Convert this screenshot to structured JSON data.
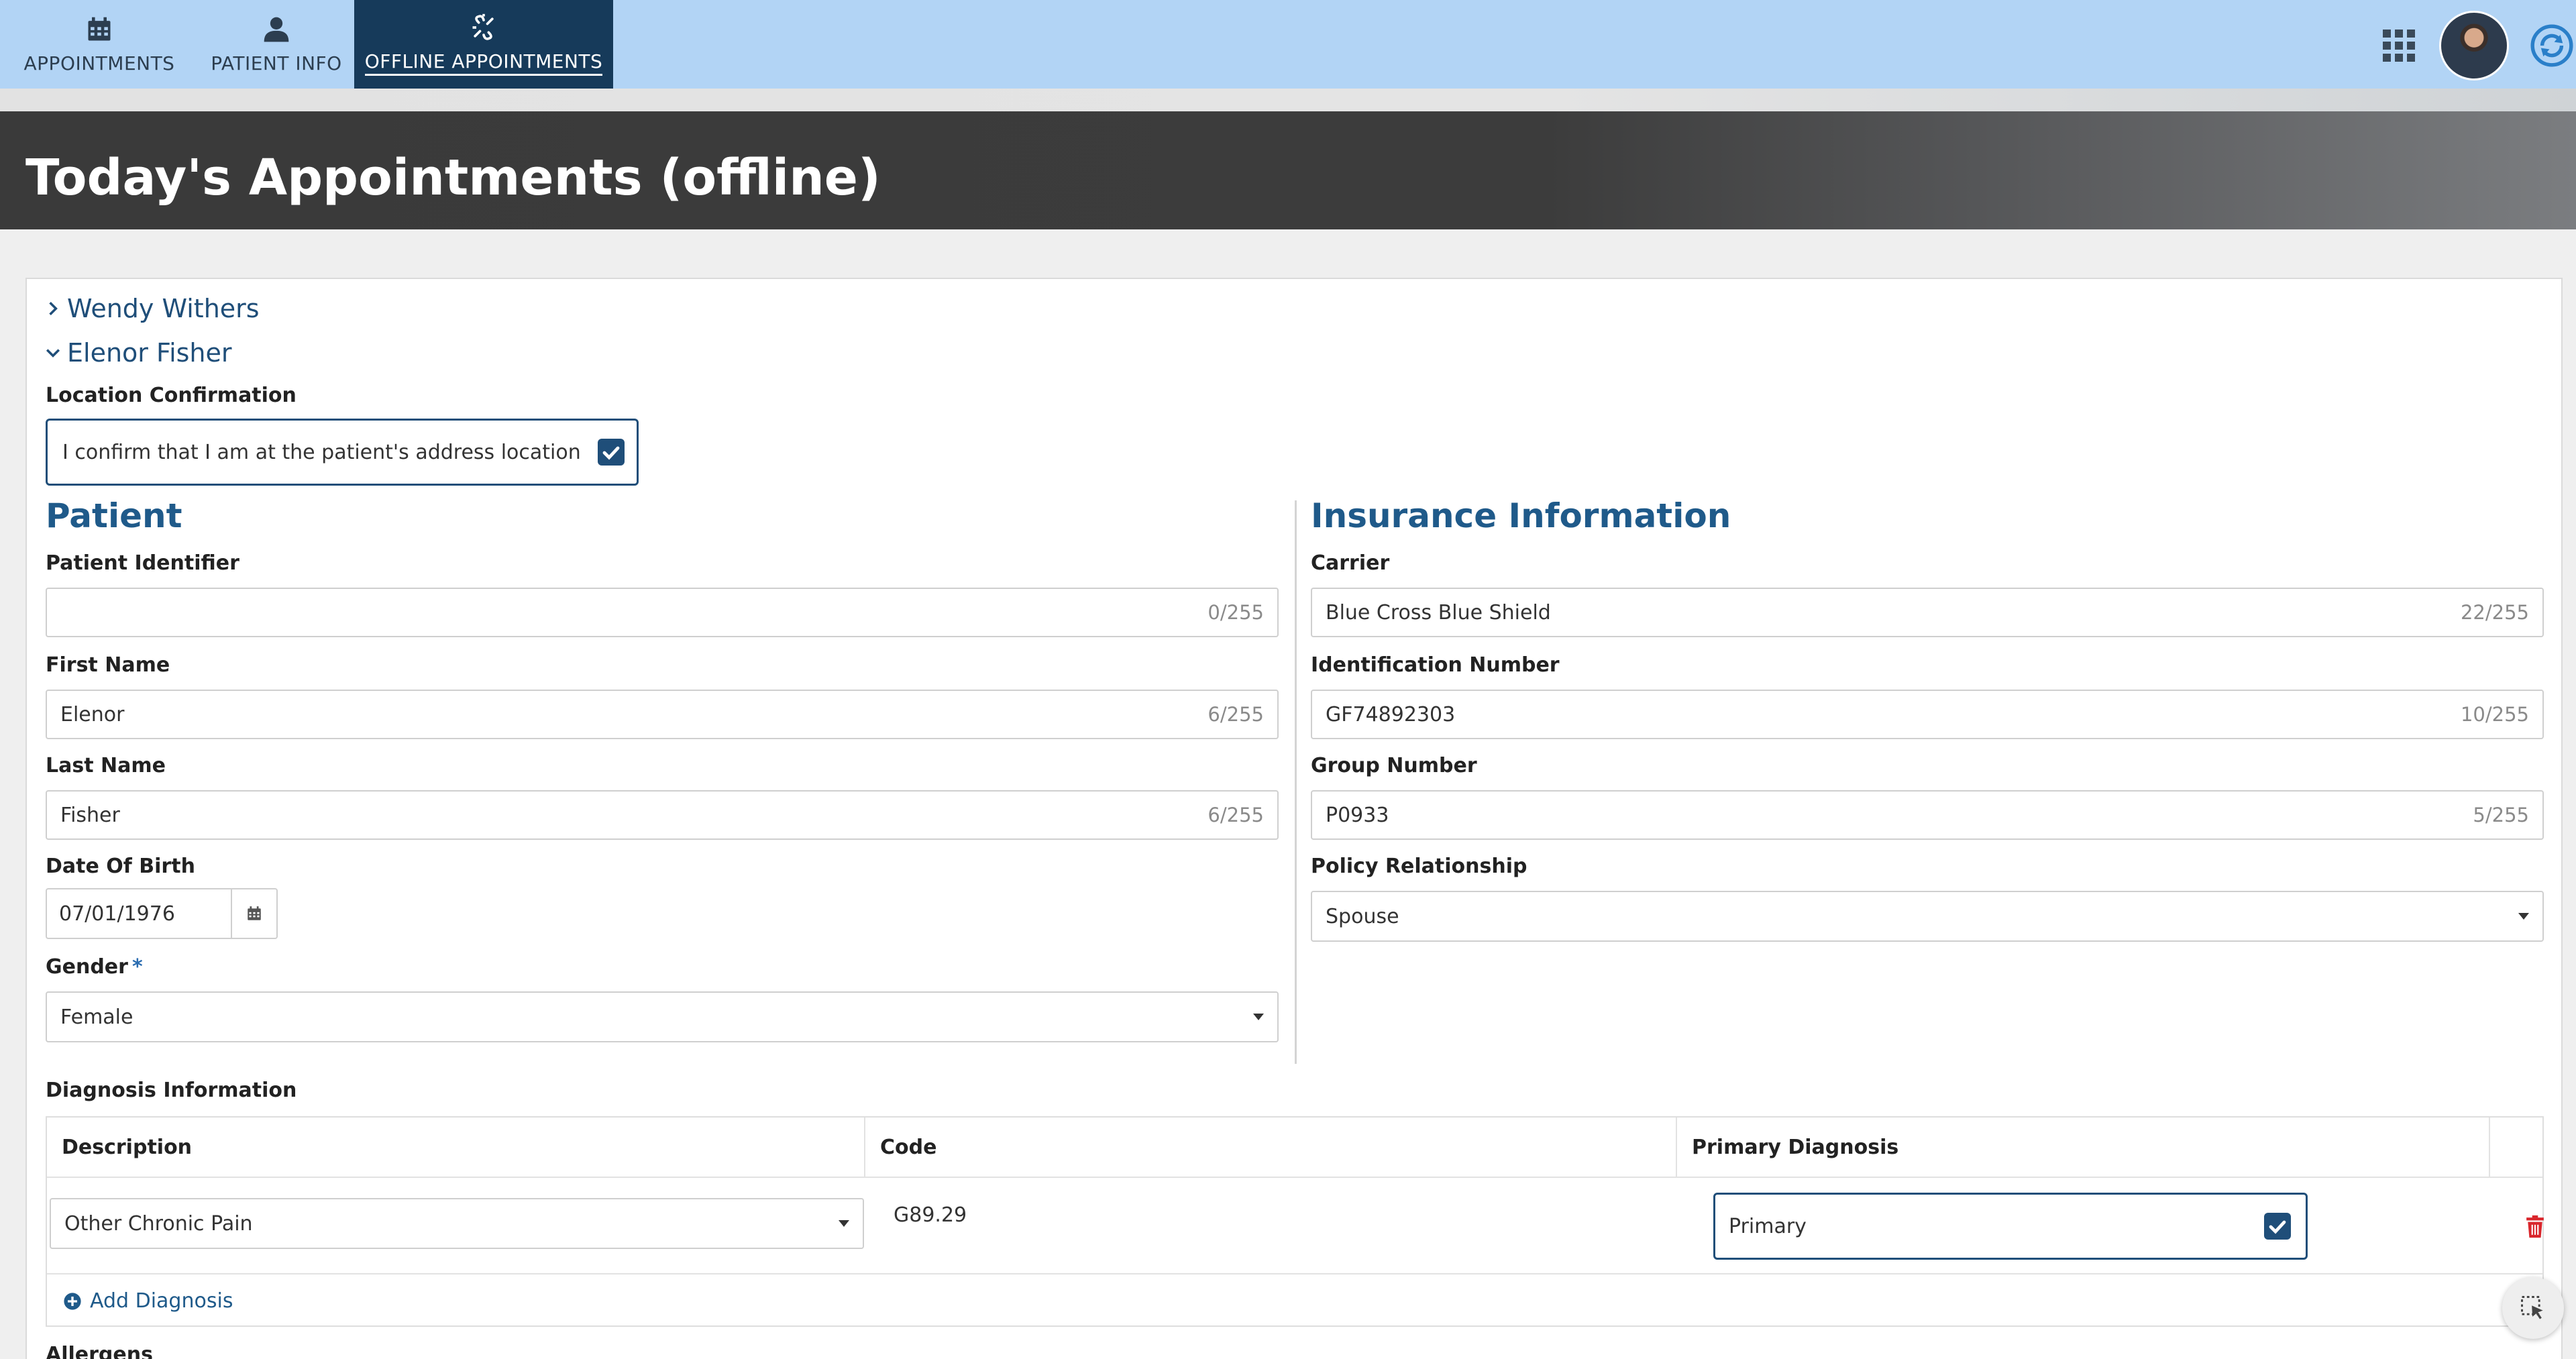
{
  "nav": {
    "items": [
      {
        "label": "APPOINTMENTS",
        "icon": "calendar-icon"
      },
      {
        "label": "PATIENT INFO",
        "icon": "person-icon"
      },
      {
        "label": "OFFLINE APPOINTMENTS",
        "icon": "offline-link-icon",
        "active": true
      }
    ]
  },
  "header": {
    "title": "Today's Appointments (offline)"
  },
  "patients": {
    "collapsed": "Wendy Withers",
    "expanded": "Elenor Fisher"
  },
  "location": {
    "label": "Location Confirmation",
    "text": "I confirm that I am at the patient's address location",
    "checked": true
  },
  "patient": {
    "title": "Patient",
    "identifier": {
      "label": "Patient Identifier",
      "value": "",
      "count": "0/255"
    },
    "first_name": {
      "label": "First Name",
      "value": "Elenor",
      "count": "6/255"
    },
    "last_name": {
      "label": "Last Name",
      "value": "Fisher",
      "count": "6/255"
    },
    "dob": {
      "label": "Date Of Birth",
      "value": "07/01/1976"
    },
    "gender": {
      "label": "Gender",
      "required_mark": "*",
      "value": "Female"
    }
  },
  "insurance": {
    "title": "Insurance Information",
    "carrier": {
      "label": "Carrier",
      "value": "Blue Cross Blue Shield",
      "count": "22/255"
    },
    "id_number": {
      "label": "Identification Number",
      "value": "GF74892303",
      "count": "10/255"
    },
    "group_number": {
      "label": "Group Number",
      "value": "P0933",
      "count": "5/255"
    },
    "policy_relationship": {
      "label": "Policy Relationship",
      "value": "Spouse"
    }
  },
  "diagnosis": {
    "label": "Diagnosis Information",
    "columns": [
      "Description",
      "Code",
      "Primary Diagnosis"
    ],
    "rows": [
      {
        "description": "Other Chronic Pain",
        "code": "G89.29",
        "primary_label": "Primary",
        "primary": true
      }
    ],
    "add_label": "Add Diagnosis"
  },
  "allergens": {
    "label": "Allergens"
  },
  "colors": {
    "accent": "#1f4e79",
    "nav_bg": "#b2d4f5",
    "nav_active": "#163a5a",
    "danger": "#d9262c"
  }
}
